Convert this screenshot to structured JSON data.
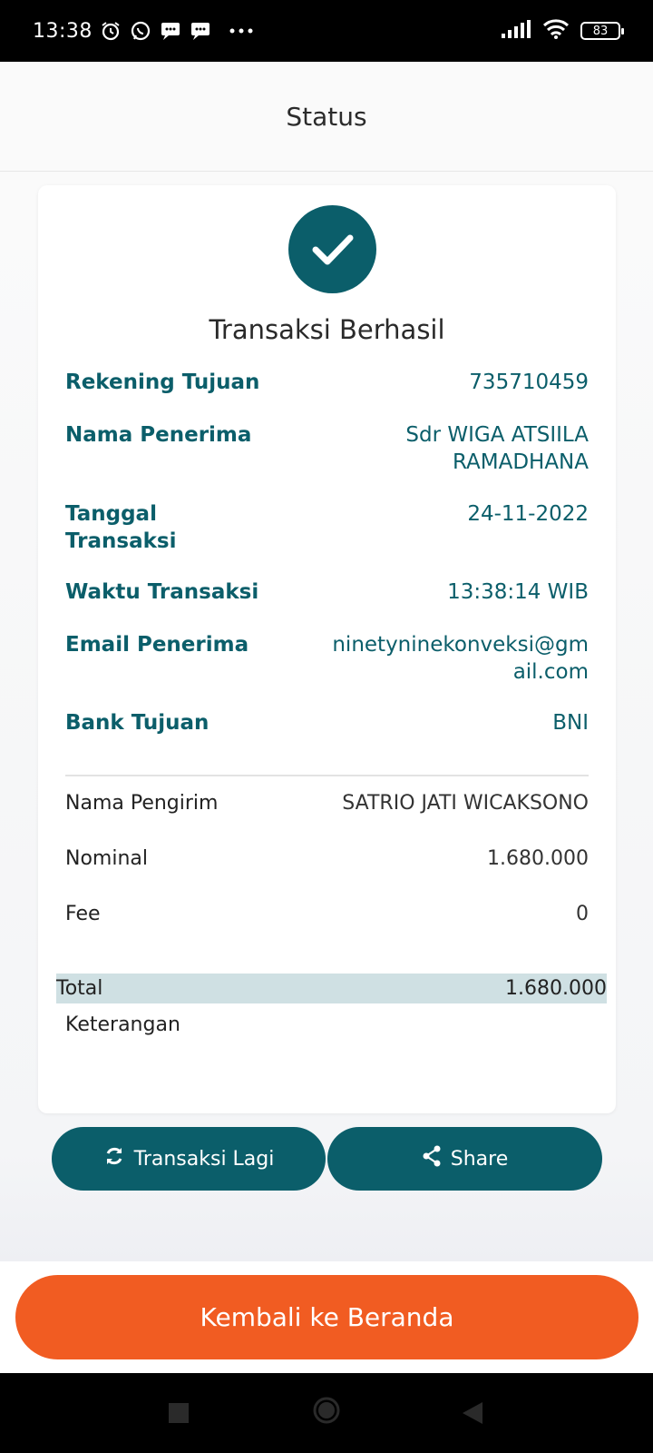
{
  "status_bar": {
    "time": "13:38",
    "battery": "83",
    "icons": [
      "alarm-icon",
      "whatsapp-icon",
      "message-icon",
      "message-icon",
      "more-dots-icon",
      "signal-icon",
      "wifi-icon",
      "battery-icon"
    ]
  },
  "header": {
    "title": "Status"
  },
  "card": {
    "title": "Transaksi Berhasil",
    "details": [
      {
        "label": "Rekening Tujuan",
        "value": "735710459"
      },
      {
        "label": "Nama Penerima",
        "value_line1": "Sdr WIGA ATSIILA",
        "value_line2": "RAMADHANA"
      },
      {
        "label_line1": "Tanggal",
        "label_line2": "Transaksi",
        "value": "24-11-2022"
      },
      {
        "label": "Waktu Transaksi",
        "value": "13:38:14 WIB"
      },
      {
        "label": "Email Penerima",
        "value_line1": "ninetyninekonveksi@gm",
        "value_line2": "ail.com"
      },
      {
        "label": "Bank Tujuan",
        "value": "BNI"
      }
    ],
    "summary": [
      {
        "label": "Nama Pengirim",
        "value": "SATRIO JATI WICAKSONO"
      },
      {
        "label": "Nominal",
        "value": "1.680.000"
      },
      {
        "label": "Fee",
        "value": "0"
      }
    ],
    "total": {
      "label": "Total",
      "value": "1.680.000"
    },
    "note": {
      "label": "Keterangan",
      "value": ""
    }
  },
  "actions": {
    "repeat_label": "Transaksi Lagi",
    "share_label": "Share",
    "home_label": "Kembali ke Beranda"
  },
  "colors": {
    "teal": "#0b5e6a",
    "orange": "#f15c22",
    "total_highlight": "#cfe0e3"
  }
}
